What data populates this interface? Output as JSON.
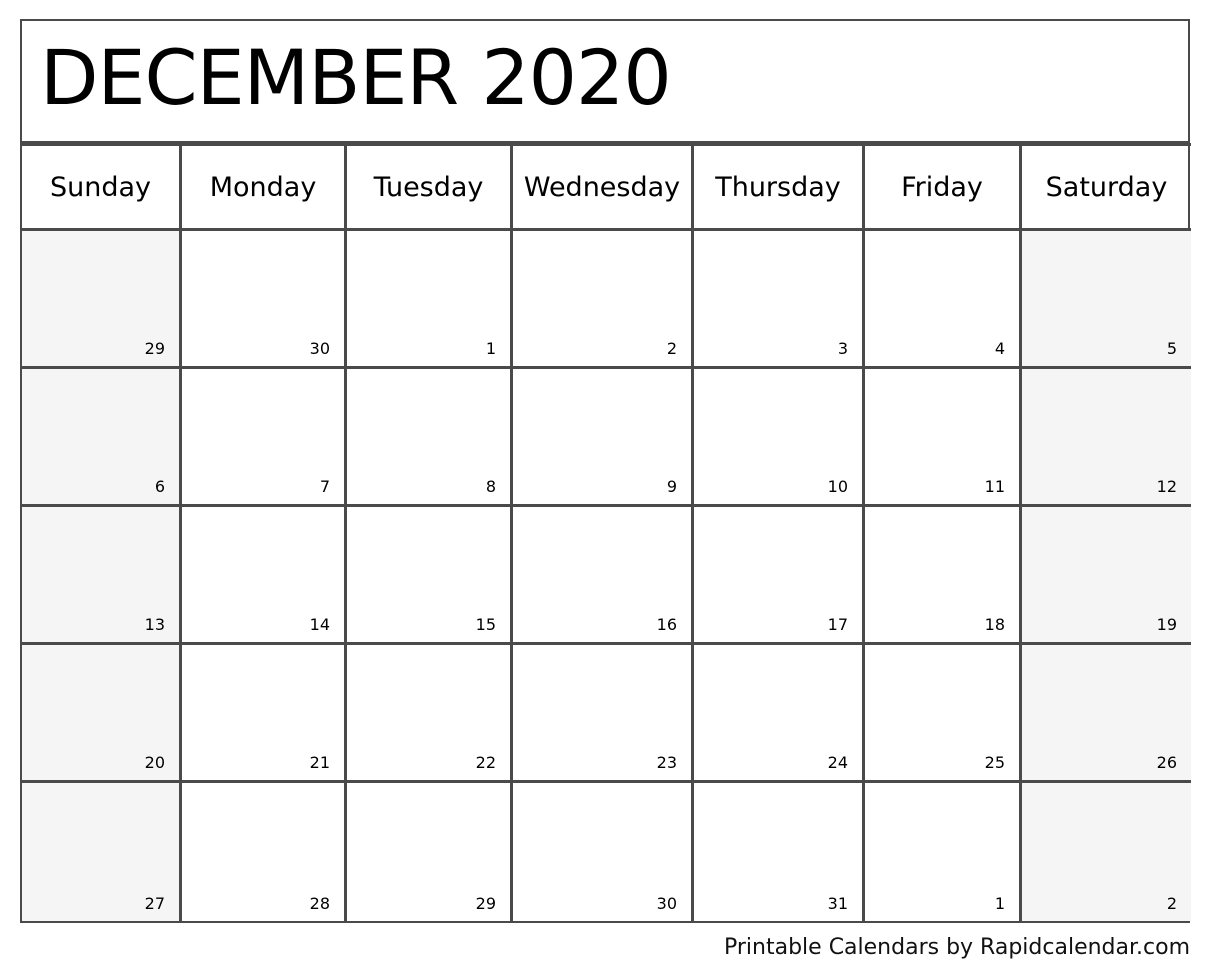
{
  "title": "DECEMBER 2020",
  "weekdays": [
    "Sunday",
    "Monday",
    "Tuesday",
    "Wednesday",
    "Thursday",
    "Friday",
    "Saturday"
  ],
  "weeks": [
    [
      "29",
      "30",
      "1",
      "2",
      "3",
      "4",
      "5"
    ],
    [
      "6",
      "7",
      "8",
      "9",
      "10",
      "11",
      "12"
    ],
    [
      "13",
      "14",
      "15",
      "16",
      "17",
      "18",
      "19"
    ],
    [
      "20",
      "21",
      "22",
      "23",
      "24",
      "25",
      "26"
    ],
    [
      "27",
      "28",
      "29",
      "30",
      "31",
      "1",
      "2"
    ]
  ],
  "footer": "Printable Calendars by Rapidcalendar.com",
  "colors": {
    "border": "#4a4a4a",
    "weekend_bg": "#f5f5f5"
  }
}
